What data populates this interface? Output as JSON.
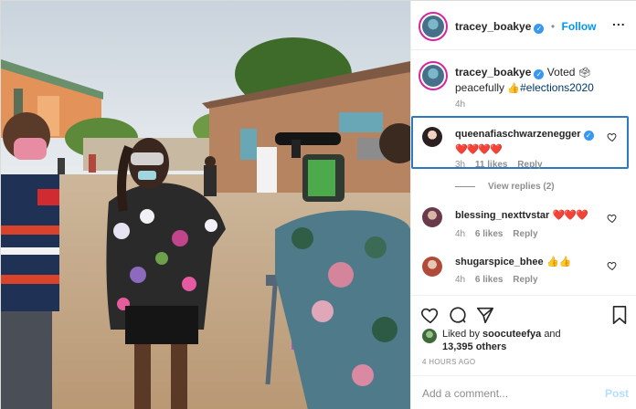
{
  "header": {
    "username": "tracey_boakye",
    "separator": "•",
    "follow_label": "Follow",
    "more_label": "..."
  },
  "caption": {
    "username": "tracey_boakye",
    "text_part1": "Voted",
    "text_part2": "peacefully",
    "hashtag": "#elections2020",
    "time": "4h"
  },
  "comments": [
    {
      "username": "queenafiaschwarzenegger",
      "verified": true,
      "emoji": "❤️❤️❤️❤️",
      "time": "3h",
      "likes": "11 likes",
      "reply": "Reply"
    },
    {
      "username": "blessing_nexttvstar",
      "emoji": "❤️❤️❤️",
      "time": "4h",
      "likes": "6 likes",
      "reply": "Reply"
    },
    {
      "username": "shugarspice_bhee",
      "emoji": "👍👍",
      "time": "4h",
      "likes": "6 likes",
      "reply": "Reply"
    }
  ],
  "view_replies": "View replies (2)",
  "likes": {
    "prefix": "Liked by",
    "user": "soocuteefya",
    "and": "and",
    "count": "13,395 others"
  },
  "timestamp": "4 HOURS AGO",
  "add_comment": {
    "placeholder": "Add a comment...",
    "post_label": "Post"
  },
  "colors": {
    "accent": "#0095f6",
    "verified": "#3897f0",
    "highlight": "#2b79c2",
    "heart_red": "#ed4956"
  },
  "icons": {
    "like": "heart-outline-icon",
    "comment": "speech-bubble-icon",
    "share": "paper-plane-icon",
    "save": "bookmark-icon"
  }
}
